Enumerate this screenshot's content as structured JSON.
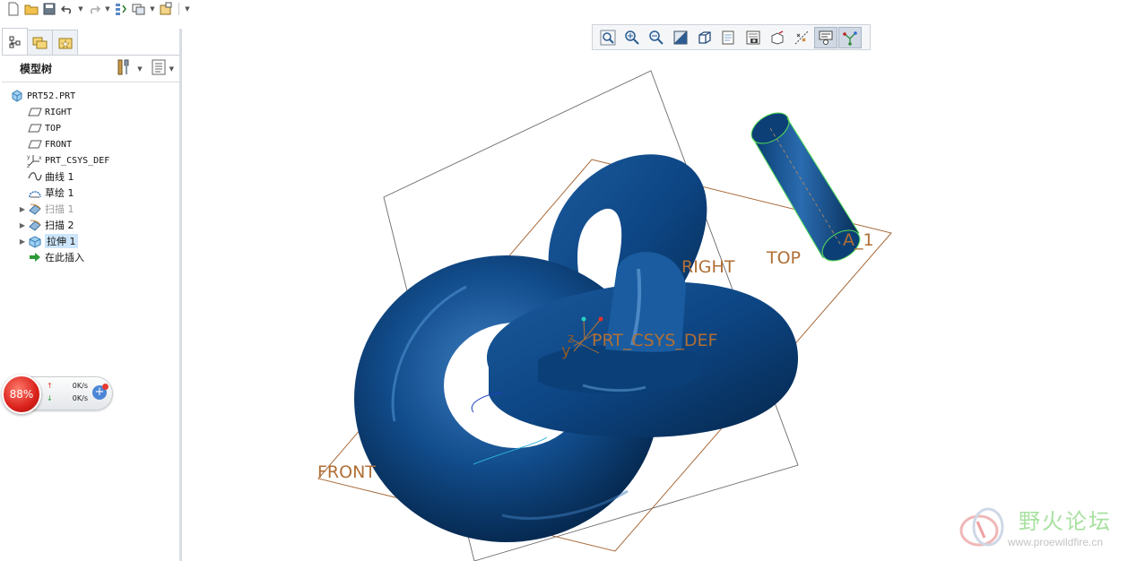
{
  "quick_access": {
    "icons": [
      "new-icon",
      "open-icon",
      "save-icon",
      "undo-icon",
      "redo-icon",
      "regenerate-icon",
      "windows-icon",
      "close-window-icon",
      "customize-icon"
    ]
  },
  "panel": {
    "tabs": [
      "model-tree-tab",
      "folder-browser-tab",
      "favorites-tab"
    ],
    "title": "模型树",
    "tree": [
      {
        "label": "PRT52.PRT",
        "icon": "part-icon",
        "expandable": false,
        "indent": 0
      },
      {
        "label": "RIGHT",
        "icon": "datum-plane-icon",
        "expandable": false,
        "indent": 1
      },
      {
        "label": "TOP",
        "icon": "datum-plane-icon",
        "expandable": false,
        "indent": 1
      },
      {
        "label": "FRONT",
        "icon": "datum-plane-icon",
        "expandable": false,
        "indent": 1
      },
      {
        "label": "PRT_CSYS_DEF",
        "icon": "csys-icon",
        "expandable": false,
        "indent": 1
      },
      {
        "label": "曲线 1",
        "icon": "curve-icon",
        "expandable": false,
        "indent": 1
      },
      {
        "label": "草绘 1",
        "icon": "sketch-icon",
        "expandable": false,
        "indent": 1
      },
      {
        "label": "扫描 1",
        "icon": "sweep-icon",
        "expandable": true,
        "indent": 1,
        "state": "suppressed"
      },
      {
        "label": "扫描 2",
        "icon": "sweep-icon",
        "expandable": true,
        "indent": 1
      },
      {
        "label": "拉伸 1",
        "icon": "extrude-icon",
        "expandable": true,
        "indent": 1,
        "state": "selected"
      },
      {
        "label": "在此插入",
        "icon": "insert-here-icon",
        "expandable": false,
        "indent": 1
      }
    ]
  },
  "view_toolbar": {
    "icons": [
      "refit-icon",
      "zoom-in-icon",
      "zoom-out-icon",
      "repaint-icon",
      "display-style-icon",
      "saved-views-icon",
      "view-manager-icon",
      "perspective-icon",
      "datum-display-icon",
      "annotation-display-icon",
      "spin-center-icon"
    ]
  },
  "network_widget": {
    "percent": "88%",
    "upload": "0K/s",
    "download": "0K/s"
  },
  "viewport": {
    "labels": {
      "right": "RIGHT",
      "top": "TOP",
      "front": "FRONT",
      "csys": "PRT_CSYS_DEF",
      "axis": "A_1",
      "axis_z": "z",
      "axis_y": "y"
    },
    "colors": {
      "solid": "#0e4a8a",
      "datum": "#9c5a2a",
      "datum_line": "#6b6b6b"
    }
  },
  "watermark": {
    "name": "野火论坛",
    "url": "www.proewildfire.cn"
  }
}
